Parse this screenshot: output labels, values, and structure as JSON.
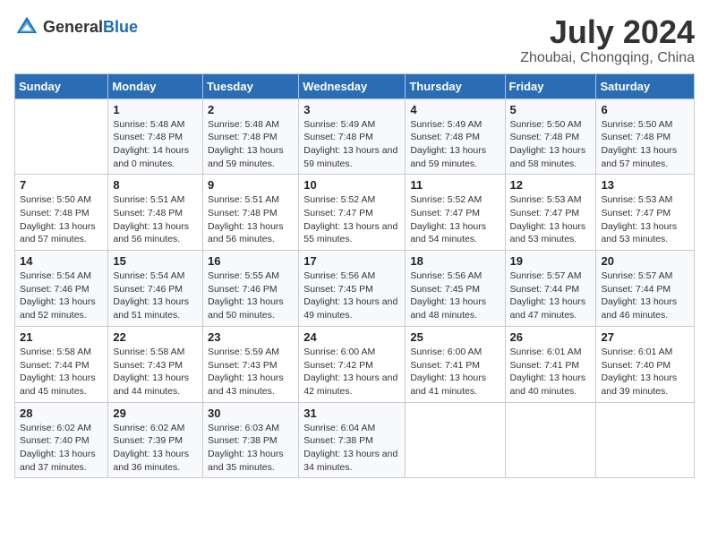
{
  "header": {
    "logo_general": "General",
    "logo_blue": "Blue",
    "month_title": "July 2024",
    "location": "Zhoubai, Chongqing, China"
  },
  "calendar": {
    "days_of_week": [
      "Sunday",
      "Monday",
      "Tuesday",
      "Wednesday",
      "Thursday",
      "Friday",
      "Saturday"
    ],
    "weeks": [
      [
        {
          "day": "",
          "info": ""
        },
        {
          "day": "1",
          "info": "Sunrise: 5:48 AM\nSunset: 7:48 PM\nDaylight: 14 hours and 0 minutes."
        },
        {
          "day": "2",
          "info": "Sunrise: 5:48 AM\nSunset: 7:48 PM\nDaylight: 13 hours and 59 minutes."
        },
        {
          "day": "3",
          "info": "Sunrise: 5:49 AM\nSunset: 7:48 PM\nDaylight: 13 hours and 59 minutes."
        },
        {
          "day": "4",
          "info": "Sunrise: 5:49 AM\nSunset: 7:48 PM\nDaylight: 13 hours and 59 minutes."
        },
        {
          "day": "5",
          "info": "Sunrise: 5:50 AM\nSunset: 7:48 PM\nDaylight: 13 hours and 58 minutes."
        },
        {
          "day": "6",
          "info": "Sunrise: 5:50 AM\nSunset: 7:48 PM\nDaylight: 13 hours and 57 minutes."
        }
      ],
      [
        {
          "day": "7",
          "info": "Sunrise: 5:50 AM\nSunset: 7:48 PM\nDaylight: 13 hours and 57 minutes."
        },
        {
          "day": "8",
          "info": "Sunrise: 5:51 AM\nSunset: 7:48 PM\nDaylight: 13 hours and 56 minutes."
        },
        {
          "day": "9",
          "info": "Sunrise: 5:51 AM\nSunset: 7:48 PM\nDaylight: 13 hours and 56 minutes."
        },
        {
          "day": "10",
          "info": "Sunrise: 5:52 AM\nSunset: 7:47 PM\nDaylight: 13 hours and 55 minutes."
        },
        {
          "day": "11",
          "info": "Sunrise: 5:52 AM\nSunset: 7:47 PM\nDaylight: 13 hours and 54 minutes."
        },
        {
          "day": "12",
          "info": "Sunrise: 5:53 AM\nSunset: 7:47 PM\nDaylight: 13 hours and 53 minutes."
        },
        {
          "day": "13",
          "info": "Sunrise: 5:53 AM\nSunset: 7:47 PM\nDaylight: 13 hours and 53 minutes."
        }
      ],
      [
        {
          "day": "14",
          "info": "Sunrise: 5:54 AM\nSunset: 7:46 PM\nDaylight: 13 hours and 52 minutes."
        },
        {
          "day": "15",
          "info": "Sunrise: 5:54 AM\nSunset: 7:46 PM\nDaylight: 13 hours and 51 minutes."
        },
        {
          "day": "16",
          "info": "Sunrise: 5:55 AM\nSunset: 7:46 PM\nDaylight: 13 hours and 50 minutes."
        },
        {
          "day": "17",
          "info": "Sunrise: 5:56 AM\nSunset: 7:45 PM\nDaylight: 13 hours and 49 minutes."
        },
        {
          "day": "18",
          "info": "Sunrise: 5:56 AM\nSunset: 7:45 PM\nDaylight: 13 hours and 48 minutes."
        },
        {
          "day": "19",
          "info": "Sunrise: 5:57 AM\nSunset: 7:44 PM\nDaylight: 13 hours and 47 minutes."
        },
        {
          "day": "20",
          "info": "Sunrise: 5:57 AM\nSunset: 7:44 PM\nDaylight: 13 hours and 46 minutes."
        }
      ],
      [
        {
          "day": "21",
          "info": "Sunrise: 5:58 AM\nSunset: 7:44 PM\nDaylight: 13 hours and 45 minutes."
        },
        {
          "day": "22",
          "info": "Sunrise: 5:58 AM\nSunset: 7:43 PM\nDaylight: 13 hours and 44 minutes."
        },
        {
          "day": "23",
          "info": "Sunrise: 5:59 AM\nSunset: 7:43 PM\nDaylight: 13 hours and 43 minutes."
        },
        {
          "day": "24",
          "info": "Sunrise: 6:00 AM\nSunset: 7:42 PM\nDaylight: 13 hours and 42 minutes."
        },
        {
          "day": "25",
          "info": "Sunrise: 6:00 AM\nSunset: 7:41 PM\nDaylight: 13 hours and 41 minutes."
        },
        {
          "day": "26",
          "info": "Sunrise: 6:01 AM\nSunset: 7:41 PM\nDaylight: 13 hours and 40 minutes."
        },
        {
          "day": "27",
          "info": "Sunrise: 6:01 AM\nSunset: 7:40 PM\nDaylight: 13 hours and 39 minutes."
        }
      ],
      [
        {
          "day": "28",
          "info": "Sunrise: 6:02 AM\nSunset: 7:40 PM\nDaylight: 13 hours and 37 minutes."
        },
        {
          "day": "29",
          "info": "Sunrise: 6:02 AM\nSunset: 7:39 PM\nDaylight: 13 hours and 36 minutes."
        },
        {
          "day": "30",
          "info": "Sunrise: 6:03 AM\nSunset: 7:38 PM\nDaylight: 13 hours and 35 minutes."
        },
        {
          "day": "31",
          "info": "Sunrise: 6:04 AM\nSunset: 7:38 PM\nDaylight: 13 hours and 34 minutes."
        },
        {
          "day": "",
          "info": ""
        },
        {
          "day": "",
          "info": ""
        },
        {
          "day": "",
          "info": ""
        }
      ]
    ]
  }
}
